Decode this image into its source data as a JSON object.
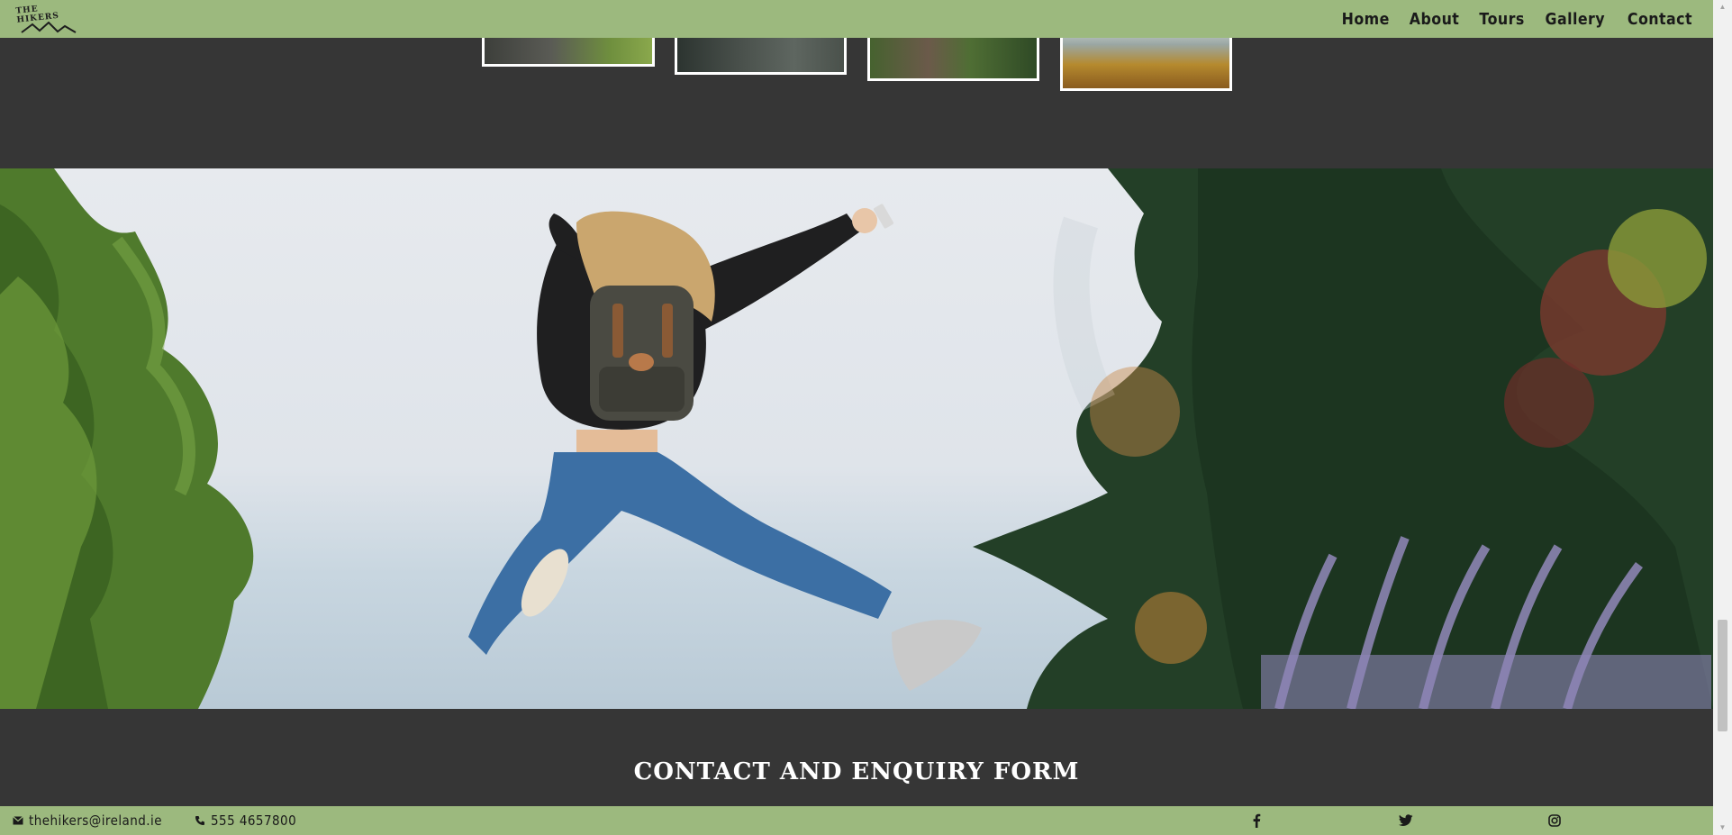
{
  "brand": {
    "logo_text": "THE HIKERS"
  },
  "nav": {
    "items": [
      "Home",
      "About",
      "Tours",
      "Gallery",
      "Contact"
    ]
  },
  "gallery": {
    "thumbs": [
      {
        "name": "gallery-thumb-1",
        "color_top": "#4a4c46",
        "color_bottom": "#7a9a4a"
      },
      {
        "name": "gallery-thumb-2",
        "color_top": "#2f3a36",
        "color_bottom": "#5c6258"
      },
      {
        "name": "gallery-thumb-3",
        "color_top": "#3f5a32",
        "color_bottom": "#6b7a3e"
      },
      {
        "name": "gallery-thumb-4",
        "color_top": "#b9c4c2",
        "color_bottom": "#a7782a"
      }
    ]
  },
  "hero": {
    "alt": "hiker-jumping-image"
  },
  "contact": {
    "title": "CONTACT AND ENQUIRY FORM"
  },
  "footer": {
    "email": "thehikers@ireland.ie",
    "phone": "555 4657800",
    "social": [
      "facebook-icon",
      "twitter-icon",
      "instagram-icon"
    ]
  },
  "colors": {
    "accent": "#9cb97e",
    "background": "#363636"
  }
}
